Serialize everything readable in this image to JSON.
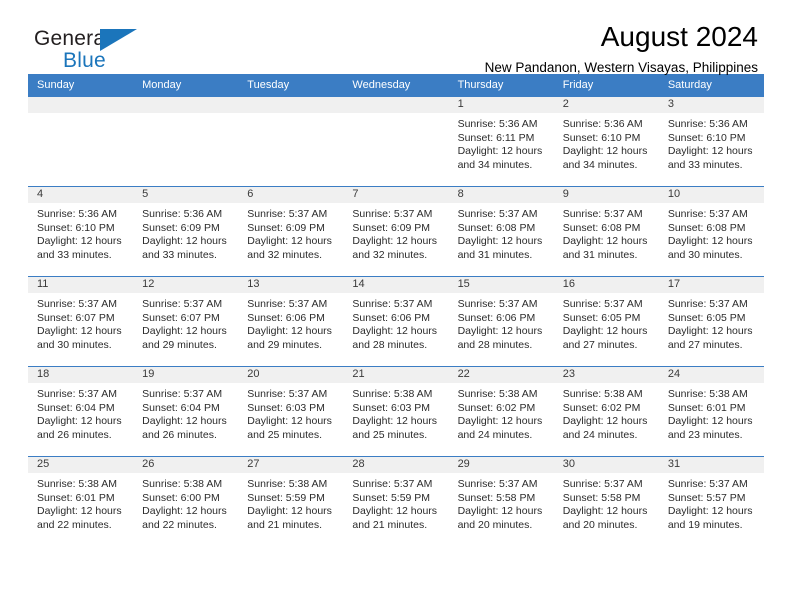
{
  "brand": {
    "name_part1": "General",
    "name_part2": "Blue",
    "logo_icon": "triangle-logo-icon"
  },
  "header": {
    "title": "August 2024",
    "subtitle": "New Pandanon, Western Visayas, Philippines"
  },
  "colors": {
    "header_blue": "#3b7dc4",
    "brand_blue": "#1b75bb",
    "daynum_band": "#f0f0f0",
    "text": "#000000"
  },
  "calendar": {
    "weekday_headers": [
      "Sunday",
      "Monday",
      "Tuesday",
      "Wednesday",
      "Thursday",
      "Friday",
      "Saturday"
    ],
    "labels": {
      "sunrise": "Sunrise:",
      "sunset": "Sunset:",
      "daylight": "Daylight:"
    },
    "weeks": [
      [
        {
          "day": "",
          "empty": true
        },
        {
          "day": "",
          "empty": true
        },
        {
          "day": "",
          "empty": true
        },
        {
          "day": "",
          "empty": true
        },
        {
          "day": "1",
          "sunrise": "Sunrise: 5:36 AM",
          "sunset": "Sunset: 6:11 PM",
          "daylight1": "Daylight: 12 hours",
          "daylight2": "and 34 minutes."
        },
        {
          "day": "2",
          "sunrise": "Sunrise: 5:36 AM",
          "sunset": "Sunset: 6:10 PM",
          "daylight1": "Daylight: 12 hours",
          "daylight2": "and 34 minutes."
        },
        {
          "day": "3",
          "sunrise": "Sunrise: 5:36 AM",
          "sunset": "Sunset: 6:10 PM",
          "daylight1": "Daylight: 12 hours",
          "daylight2": "and 33 minutes."
        }
      ],
      [
        {
          "day": "4",
          "sunrise": "Sunrise: 5:36 AM",
          "sunset": "Sunset: 6:10 PM",
          "daylight1": "Daylight: 12 hours",
          "daylight2": "and 33 minutes."
        },
        {
          "day": "5",
          "sunrise": "Sunrise: 5:36 AM",
          "sunset": "Sunset: 6:09 PM",
          "daylight1": "Daylight: 12 hours",
          "daylight2": "and 33 minutes."
        },
        {
          "day": "6",
          "sunrise": "Sunrise: 5:37 AM",
          "sunset": "Sunset: 6:09 PM",
          "daylight1": "Daylight: 12 hours",
          "daylight2": "and 32 minutes."
        },
        {
          "day": "7",
          "sunrise": "Sunrise: 5:37 AM",
          "sunset": "Sunset: 6:09 PM",
          "daylight1": "Daylight: 12 hours",
          "daylight2": "and 32 minutes."
        },
        {
          "day": "8",
          "sunrise": "Sunrise: 5:37 AM",
          "sunset": "Sunset: 6:08 PM",
          "daylight1": "Daylight: 12 hours",
          "daylight2": "and 31 minutes."
        },
        {
          "day": "9",
          "sunrise": "Sunrise: 5:37 AM",
          "sunset": "Sunset: 6:08 PM",
          "daylight1": "Daylight: 12 hours",
          "daylight2": "and 31 minutes."
        },
        {
          "day": "10",
          "sunrise": "Sunrise: 5:37 AM",
          "sunset": "Sunset: 6:08 PM",
          "daylight1": "Daylight: 12 hours",
          "daylight2": "and 30 minutes."
        }
      ],
      [
        {
          "day": "11",
          "sunrise": "Sunrise: 5:37 AM",
          "sunset": "Sunset: 6:07 PM",
          "daylight1": "Daylight: 12 hours",
          "daylight2": "and 30 minutes."
        },
        {
          "day": "12",
          "sunrise": "Sunrise: 5:37 AM",
          "sunset": "Sunset: 6:07 PM",
          "daylight1": "Daylight: 12 hours",
          "daylight2": "and 29 minutes."
        },
        {
          "day": "13",
          "sunrise": "Sunrise: 5:37 AM",
          "sunset": "Sunset: 6:06 PM",
          "daylight1": "Daylight: 12 hours",
          "daylight2": "and 29 minutes."
        },
        {
          "day": "14",
          "sunrise": "Sunrise: 5:37 AM",
          "sunset": "Sunset: 6:06 PM",
          "daylight1": "Daylight: 12 hours",
          "daylight2": "and 28 minutes."
        },
        {
          "day": "15",
          "sunrise": "Sunrise: 5:37 AM",
          "sunset": "Sunset: 6:06 PM",
          "daylight1": "Daylight: 12 hours",
          "daylight2": "and 28 minutes."
        },
        {
          "day": "16",
          "sunrise": "Sunrise: 5:37 AM",
          "sunset": "Sunset: 6:05 PM",
          "daylight1": "Daylight: 12 hours",
          "daylight2": "and 27 minutes."
        },
        {
          "day": "17",
          "sunrise": "Sunrise: 5:37 AM",
          "sunset": "Sunset: 6:05 PM",
          "daylight1": "Daylight: 12 hours",
          "daylight2": "and 27 minutes."
        }
      ],
      [
        {
          "day": "18",
          "sunrise": "Sunrise: 5:37 AM",
          "sunset": "Sunset: 6:04 PM",
          "daylight1": "Daylight: 12 hours",
          "daylight2": "and 26 minutes."
        },
        {
          "day": "19",
          "sunrise": "Sunrise: 5:37 AM",
          "sunset": "Sunset: 6:04 PM",
          "daylight1": "Daylight: 12 hours",
          "daylight2": "and 26 minutes."
        },
        {
          "day": "20",
          "sunrise": "Sunrise: 5:37 AM",
          "sunset": "Sunset: 6:03 PM",
          "daylight1": "Daylight: 12 hours",
          "daylight2": "and 25 minutes."
        },
        {
          "day": "21",
          "sunrise": "Sunrise: 5:38 AM",
          "sunset": "Sunset: 6:03 PM",
          "daylight1": "Daylight: 12 hours",
          "daylight2": "and 25 minutes."
        },
        {
          "day": "22",
          "sunrise": "Sunrise: 5:38 AM",
          "sunset": "Sunset: 6:02 PM",
          "daylight1": "Daylight: 12 hours",
          "daylight2": "and 24 minutes."
        },
        {
          "day": "23",
          "sunrise": "Sunrise: 5:38 AM",
          "sunset": "Sunset: 6:02 PM",
          "daylight1": "Daylight: 12 hours",
          "daylight2": "and 24 minutes."
        },
        {
          "day": "24",
          "sunrise": "Sunrise: 5:38 AM",
          "sunset": "Sunset: 6:01 PM",
          "daylight1": "Daylight: 12 hours",
          "daylight2": "and 23 minutes."
        }
      ],
      [
        {
          "day": "25",
          "sunrise": "Sunrise: 5:38 AM",
          "sunset": "Sunset: 6:01 PM",
          "daylight1": "Daylight: 12 hours",
          "daylight2": "and 22 minutes."
        },
        {
          "day": "26",
          "sunrise": "Sunrise: 5:38 AM",
          "sunset": "Sunset: 6:00 PM",
          "daylight1": "Daylight: 12 hours",
          "daylight2": "and 22 minutes."
        },
        {
          "day": "27",
          "sunrise": "Sunrise: 5:38 AM",
          "sunset": "Sunset: 5:59 PM",
          "daylight1": "Daylight: 12 hours",
          "daylight2": "and 21 minutes."
        },
        {
          "day": "28",
          "sunrise": "Sunrise: 5:37 AM",
          "sunset": "Sunset: 5:59 PM",
          "daylight1": "Daylight: 12 hours",
          "daylight2": "and 21 minutes."
        },
        {
          "day": "29",
          "sunrise": "Sunrise: 5:37 AM",
          "sunset": "Sunset: 5:58 PM",
          "daylight1": "Daylight: 12 hours",
          "daylight2": "and 20 minutes."
        },
        {
          "day": "30",
          "sunrise": "Sunrise: 5:37 AM",
          "sunset": "Sunset: 5:58 PM",
          "daylight1": "Daylight: 12 hours",
          "daylight2": "and 20 minutes."
        },
        {
          "day": "31",
          "sunrise": "Sunrise: 5:37 AM",
          "sunset": "Sunset: 5:57 PM",
          "daylight1": "Daylight: 12 hours",
          "daylight2": "and 19 minutes."
        }
      ]
    ]
  }
}
